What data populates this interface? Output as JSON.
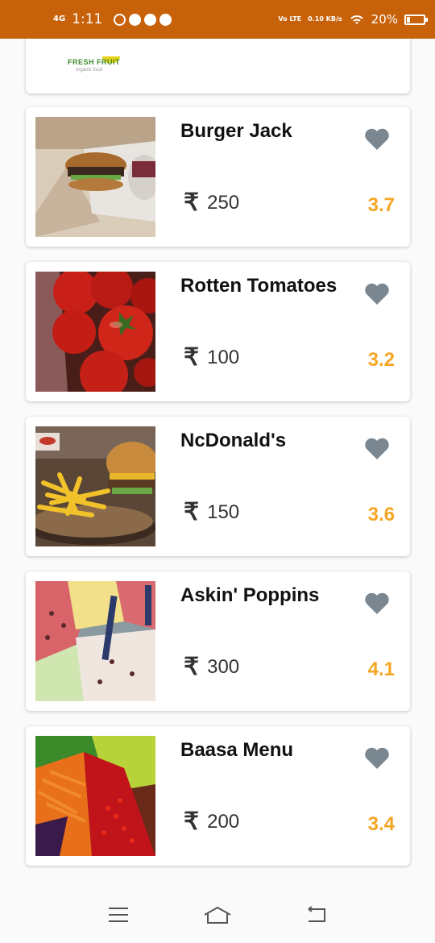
{
  "status_bar": {
    "network": "4G",
    "time": "1:11",
    "volte": "Vo LTE",
    "speed": "0.10 KB/s",
    "battery": "20%"
  },
  "partial_card": {
    "logo_text": "FRESH FRUIT",
    "logo_sub": "organic food"
  },
  "restaurants": [
    {
      "name": "Burger Jack",
      "price": "250",
      "rating": "3.7",
      "image": "burger-photo"
    },
    {
      "name": "Rotten Tomatoes",
      "price": "100",
      "rating": "3.2",
      "image": "tomatoes-photo"
    },
    {
      "name": "NcDonald's",
      "price": "150",
      "rating": "3.6",
      "image": "burger-fries-photo"
    },
    {
      "name": "Askin' Poppins",
      "price": "300",
      "rating": "4.1",
      "image": "ice-cream-photo"
    },
    {
      "name": "Baasa Menu",
      "price": "200",
      "rating": "3.4",
      "image": "vegetables-photo"
    }
  ],
  "currency_symbol": "₹",
  "colors": {
    "status_bar": "#c8620a",
    "rating": "#f5a623",
    "heart": "#7b8790"
  },
  "nav_bar": {
    "icons": [
      "menu-icon",
      "home-icon",
      "back-icon"
    ]
  }
}
